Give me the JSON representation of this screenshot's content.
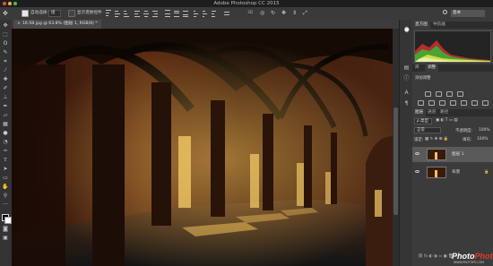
{
  "app": {
    "title": "Adobe Photoshop CC 2015"
  },
  "options_bar": {
    "auto_select_label": "自动选择:",
    "auto_select_value": "组",
    "show_transform_label": "显示变换控件",
    "workspace": "基本"
  },
  "document": {
    "tab_label": "16-58.jpg @ 63.8% (图层 1, RGB/8) *"
  },
  "panels": {
    "histogram_tabs": [
      "直方图",
      "导航器"
    ],
    "adjust_tabs": [
      "库",
      "调整"
    ],
    "adjust_heading": "添加调整",
    "layer_tabs": [
      "图层",
      "通道",
      "路径"
    ],
    "kind_filter": "ρ 类型",
    "blend_mode": "正常",
    "opacity_label": "不透明度:",
    "opacity_value": "100%",
    "lock_label": "锁定:",
    "fill_label": "填充:",
    "fill_value": "100%",
    "layers": [
      {
        "name": "图层 1",
        "selected": true
      },
      {
        "name": "背景",
        "selected": false
      }
    ]
  },
  "watermark": {
    "brand_a": "Photo",
    "brand_b": "Photo",
    "sub": "WWW.PHOTOPS.COM"
  },
  "colors": {
    "accent": "#2f6ad8",
    "warm_light": "#f3c15a",
    "hist_red": "#d03030",
    "hist_green": "#36b836",
    "hist_yellow": "#e2e24a"
  }
}
